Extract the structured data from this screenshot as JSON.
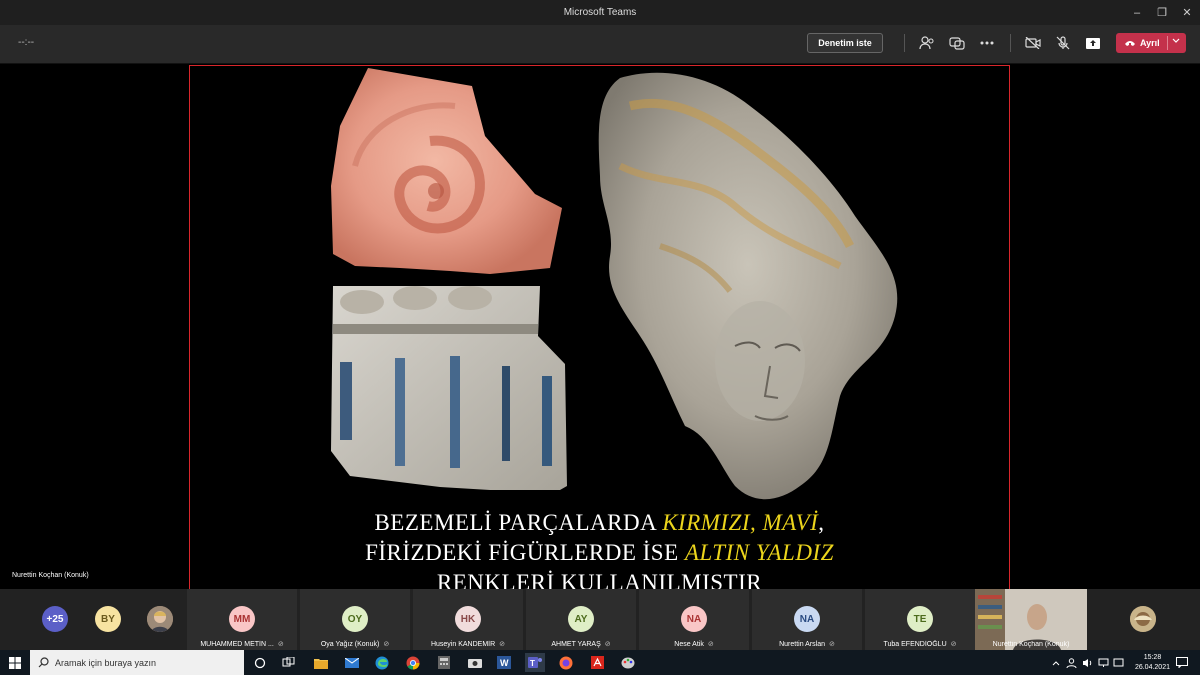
{
  "window": {
    "title": "Microsoft Teams"
  },
  "toolbar": {
    "timer": "--:--",
    "start_recording_label": "Denetim iste",
    "leave_label": "Ayrıl"
  },
  "slide": {
    "caption_line1_prefix": "BEZEMELİ PARÇALARDA ",
    "caption_line1_highlight": "KIRMIZI, MAVİ",
    "caption_line1_suffix": ",",
    "caption_line2_prefix": "FİRİZDEKİ FİGÜRLERDE İSE ",
    "caption_line2_highlight": "ALTIN YALDIZ",
    "caption_line3": "RENKLERİ KULLANILMIŞTIR",
    "highlight_color": "#ecd51c",
    "border_color": "#d9262b"
  },
  "stage": {
    "speaker_label": "Nurettin Koçhan (Konuk)"
  },
  "participants": {
    "overflow_count": "+25",
    "by_initials": "BY",
    "tiles": [
      {
        "initials": "MM",
        "name": "MUHAMMED METİN ..."
      },
      {
        "initials": "OY",
        "name": "Oya Yağız (Konuk)"
      },
      {
        "initials": "HK",
        "name": "Huseyin KANDEMİR"
      },
      {
        "initials": "AY",
        "name": "AHMET YARAŞ"
      },
      {
        "initials": "NA",
        "name": "Nese Atik"
      },
      {
        "initials": "NA",
        "name": "Nurettin Arslan"
      },
      {
        "initials": "TE",
        "name": "Tuba EFENDİOĞLU"
      }
    ],
    "video_name": "Nurettin Koçhan (Konuk)"
  },
  "taskbar": {
    "search_placeholder": "Aramak için buraya yazın",
    "time": "15:28",
    "date": "26.04.2021"
  },
  "icons": [
    "windows-icon",
    "search-icon",
    "task-view-icon",
    "file-explorer-icon",
    "mail-icon",
    "edge-icon",
    "chrome-icon",
    "camera-icon",
    "word-icon",
    "teams-icon",
    "firefox-icon",
    "acrobat-icon",
    "paint-icon"
  ]
}
